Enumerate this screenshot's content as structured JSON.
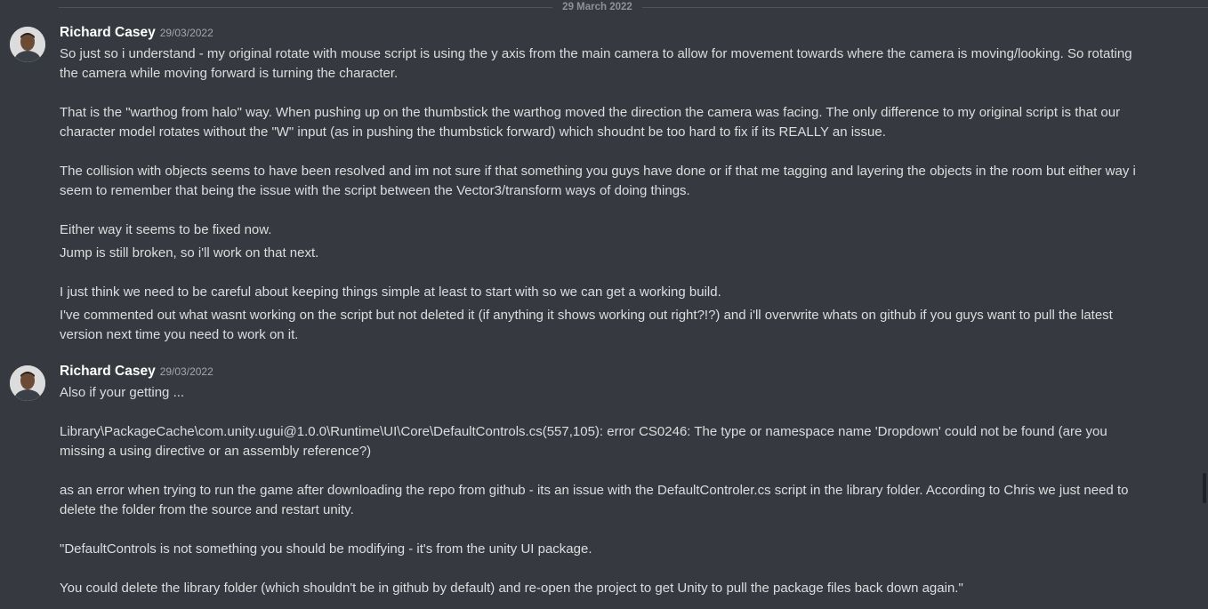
{
  "date_divider": "29 March 2022",
  "messages": [
    {
      "author": "Richard Casey",
      "timestamp": "29/03/2022",
      "lines": [
        "So just so i understand - my original rotate with mouse script is using the y axis from the main camera to allow for movement towards where the camera is moving/looking. So rotating the camera while moving forward is turning the character.",
        "That is the \"warthog from halo\" way. When pushing up on the thumbstick the warthog moved the direction the camera was facing. The only difference to my original script is that our character model rotates without the \"W\" input (as in pushing the thumbstick forward) which shoudnt be too hard to fix if its REALLY an issue.",
        "The collision with objects seems to have been resolved and im not sure if that something you guys have done or if that me tagging and layering the objects in the room but either way i seem to remember that being the issue with the script between the Vector3/transform ways of doing things.",
        "Either way it seems to be fixed now.",
        "Jump is still broken, so i'll work on that next.",
        "I just think we need to be careful about keeping things simple at least to start with so we can get a working build.",
        "I've commented out what wasnt working on the script but not deleted it (if anything it shows working out right?!?) and i'll overwrite whats on github if you guys want to pull the latest version next time you need to work on it."
      ]
    },
    {
      "author": "Richard Casey",
      "timestamp": "29/03/2022",
      "lines": [
        "Also if your getting ...",
        "Library\\PackageCache\\com.unity.ugui@1.0.0\\Runtime\\UI\\Core\\DefaultControls.cs(557,105): error CS0246: The type or namespace name 'Dropdown' could not be found (are you missing a using directive or an assembly reference?)",
        "as an error when trying to run the game after downloading the repo from github - its an issue with the DefaultControler.cs script in the library folder. According to Chris we just need to delete the folder from the source and restart unity.",
        "\"DefaultControls is not something you should be modifying - it's from the unity UI package.",
        "You could delete the library folder (which shouldn't be in github by default) and re-open the project to get Unity to pull the package files back down again.\""
      ]
    }
  ]
}
